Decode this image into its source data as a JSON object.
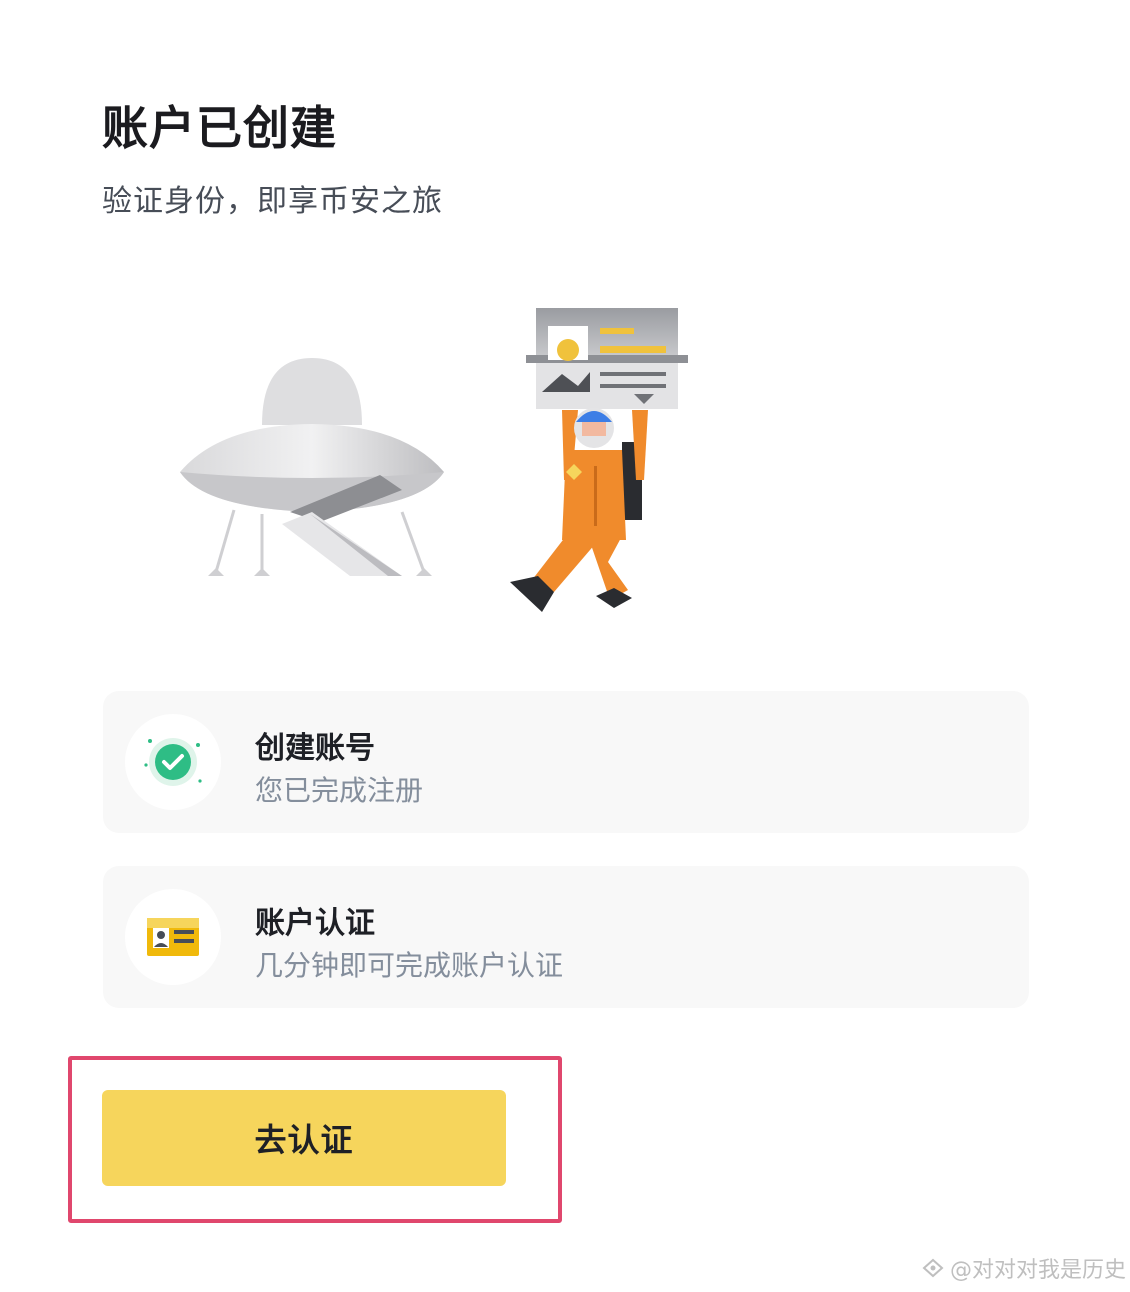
{
  "header": {
    "title": "账户已创建",
    "subtitle": "验证身份，即享币安之旅"
  },
  "steps": [
    {
      "title": "创建账号",
      "description": "您已完成注册",
      "icon": "check-circle-icon",
      "status": "done",
      "color": "#2ebd85"
    },
    {
      "title": "账户认证",
      "description": "几分钟即可完成账户认证",
      "icon": "id-card-icon",
      "status": "pending",
      "color": "#f0b90b"
    }
  ],
  "action": {
    "button_label": "去认证",
    "button_color": "#f6d55c",
    "highlight_color": "#e0476d"
  },
  "watermark": {
    "text": "@对对对我是历史"
  }
}
